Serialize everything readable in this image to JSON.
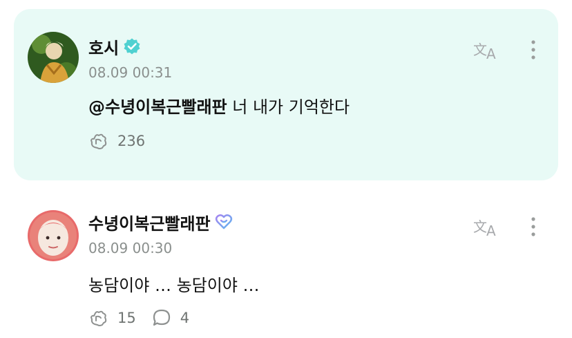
{
  "posts": [
    {
      "author": "호시",
      "badge": "verified-check",
      "timestamp": "08.09 00:31",
      "mention": "@수녕이복근빨래판",
      "text": " 너 내가 기억한다",
      "likes": "236",
      "comments": "",
      "highlight_color": "#e8faf6"
    },
    {
      "author": "수녕이복근빨래판",
      "badge": "fan-heart",
      "timestamp": "08.09 00:30",
      "mention": "",
      "text": "농담이야 … 농담이야 …",
      "likes": "15",
      "comments": "4"
    }
  ],
  "colors": {
    "verified": "#4fd1d1",
    "meta_gray": "#8a8f8d",
    "icon_gray": "#a7a9ac"
  }
}
